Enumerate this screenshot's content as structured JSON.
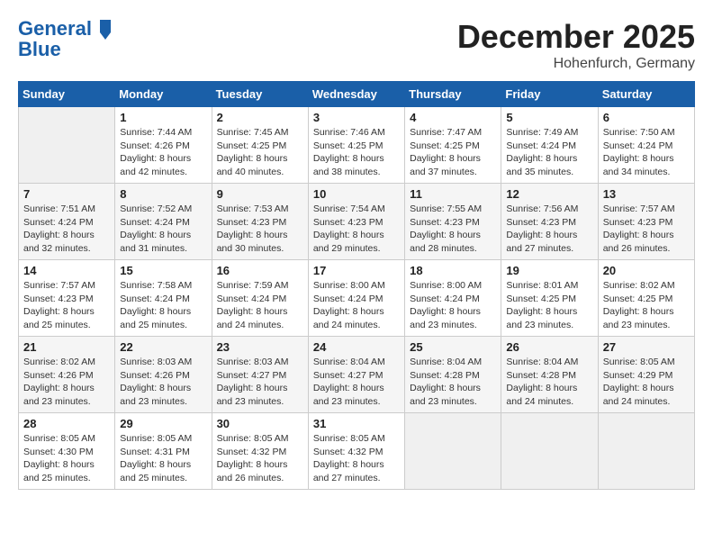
{
  "header": {
    "logo_line1": "General",
    "logo_line2": "Blue",
    "month": "December 2025",
    "location": "Hohenfurch, Germany"
  },
  "columns": [
    "Sunday",
    "Monday",
    "Tuesday",
    "Wednesday",
    "Thursday",
    "Friday",
    "Saturday"
  ],
  "weeks": [
    [
      {
        "day": "",
        "info": ""
      },
      {
        "day": "1",
        "info": "Sunrise: 7:44 AM\nSunset: 4:26 PM\nDaylight: 8 hours\nand 42 minutes."
      },
      {
        "day": "2",
        "info": "Sunrise: 7:45 AM\nSunset: 4:25 PM\nDaylight: 8 hours\nand 40 minutes."
      },
      {
        "day": "3",
        "info": "Sunrise: 7:46 AM\nSunset: 4:25 PM\nDaylight: 8 hours\nand 38 minutes."
      },
      {
        "day": "4",
        "info": "Sunrise: 7:47 AM\nSunset: 4:25 PM\nDaylight: 8 hours\nand 37 minutes."
      },
      {
        "day": "5",
        "info": "Sunrise: 7:49 AM\nSunset: 4:24 PM\nDaylight: 8 hours\nand 35 minutes."
      },
      {
        "day": "6",
        "info": "Sunrise: 7:50 AM\nSunset: 4:24 PM\nDaylight: 8 hours\nand 34 minutes."
      }
    ],
    [
      {
        "day": "7",
        "info": "Sunrise: 7:51 AM\nSunset: 4:24 PM\nDaylight: 8 hours\nand 32 minutes."
      },
      {
        "day": "8",
        "info": "Sunrise: 7:52 AM\nSunset: 4:24 PM\nDaylight: 8 hours\nand 31 minutes."
      },
      {
        "day": "9",
        "info": "Sunrise: 7:53 AM\nSunset: 4:23 PM\nDaylight: 8 hours\nand 30 minutes."
      },
      {
        "day": "10",
        "info": "Sunrise: 7:54 AM\nSunset: 4:23 PM\nDaylight: 8 hours\nand 29 minutes."
      },
      {
        "day": "11",
        "info": "Sunrise: 7:55 AM\nSunset: 4:23 PM\nDaylight: 8 hours\nand 28 minutes."
      },
      {
        "day": "12",
        "info": "Sunrise: 7:56 AM\nSunset: 4:23 PM\nDaylight: 8 hours\nand 27 minutes."
      },
      {
        "day": "13",
        "info": "Sunrise: 7:57 AM\nSunset: 4:23 PM\nDaylight: 8 hours\nand 26 minutes."
      }
    ],
    [
      {
        "day": "14",
        "info": "Sunrise: 7:57 AM\nSunset: 4:23 PM\nDaylight: 8 hours\nand 25 minutes."
      },
      {
        "day": "15",
        "info": "Sunrise: 7:58 AM\nSunset: 4:24 PM\nDaylight: 8 hours\nand 25 minutes."
      },
      {
        "day": "16",
        "info": "Sunrise: 7:59 AM\nSunset: 4:24 PM\nDaylight: 8 hours\nand 24 minutes."
      },
      {
        "day": "17",
        "info": "Sunrise: 8:00 AM\nSunset: 4:24 PM\nDaylight: 8 hours\nand 24 minutes."
      },
      {
        "day": "18",
        "info": "Sunrise: 8:00 AM\nSunset: 4:24 PM\nDaylight: 8 hours\nand 23 minutes."
      },
      {
        "day": "19",
        "info": "Sunrise: 8:01 AM\nSunset: 4:25 PM\nDaylight: 8 hours\nand 23 minutes."
      },
      {
        "day": "20",
        "info": "Sunrise: 8:02 AM\nSunset: 4:25 PM\nDaylight: 8 hours\nand 23 minutes."
      }
    ],
    [
      {
        "day": "21",
        "info": "Sunrise: 8:02 AM\nSunset: 4:26 PM\nDaylight: 8 hours\nand 23 minutes."
      },
      {
        "day": "22",
        "info": "Sunrise: 8:03 AM\nSunset: 4:26 PM\nDaylight: 8 hours\nand 23 minutes."
      },
      {
        "day": "23",
        "info": "Sunrise: 8:03 AM\nSunset: 4:27 PM\nDaylight: 8 hours\nand 23 minutes."
      },
      {
        "day": "24",
        "info": "Sunrise: 8:04 AM\nSunset: 4:27 PM\nDaylight: 8 hours\nand 23 minutes."
      },
      {
        "day": "25",
        "info": "Sunrise: 8:04 AM\nSunset: 4:28 PM\nDaylight: 8 hours\nand 23 minutes."
      },
      {
        "day": "26",
        "info": "Sunrise: 8:04 AM\nSunset: 4:28 PM\nDaylight: 8 hours\nand 24 minutes."
      },
      {
        "day": "27",
        "info": "Sunrise: 8:05 AM\nSunset: 4:29 PM\nDaylight: 8 hours\nand 24 minutes."
      }
    ],
    [
      {
        "day": "28",
        "info": "Sunrise: 8:05 AM\nSunset: 4:30 PM\nDaylight: 8 hours\nand 25 minutes."
      },
      {
        "day": "29",
        "info": "Sunrise: 8:05 AM\nSunset: 4:31 PM\nDaylight: 8 hours\nand 25 minutes."
      },
      {
        "day": "30",
        "info": "Sunrise: 8:05 AM\nSunset: 4:32 PM\nDaylight: 8 hours\nand 26 minutes."
      },
      {
        "day": "31",
        "info": "Sunrise: 8:05 AM\nSunset: 4:32 PM\nDaylight: 8 hours\nand 27 minutes."
      },
      {
        "day": "",
        "info": ""
      },
      {
        "day": "",
        "info": ""
      },
      {
        "day": "",
        "info": ""
      }
    ]
  ]
}
